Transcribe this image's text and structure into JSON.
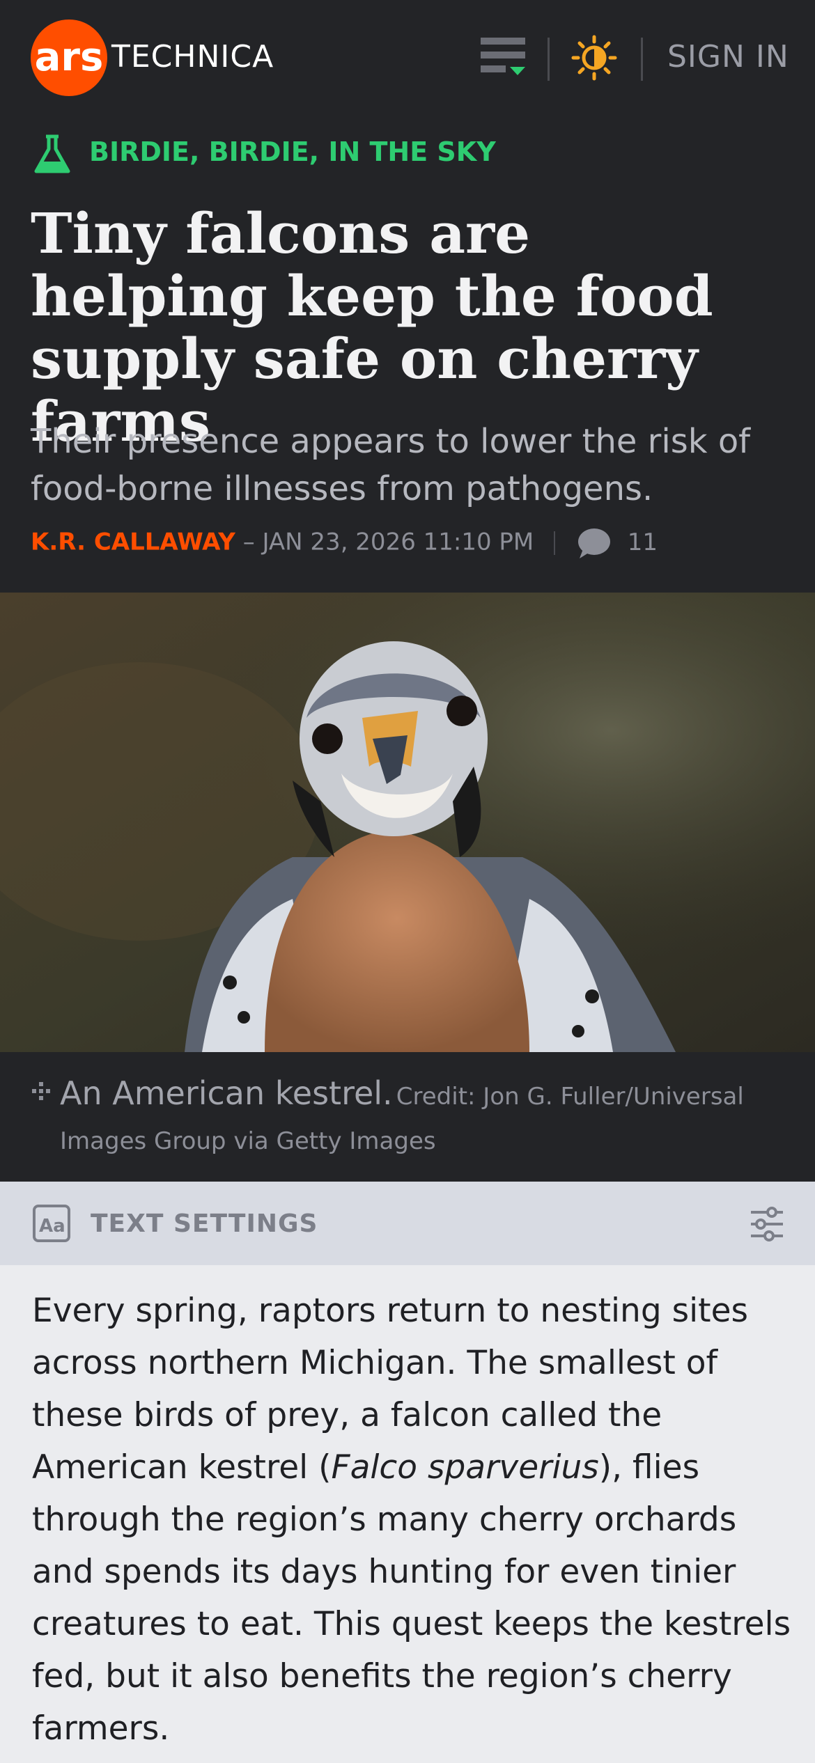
{
  "header": {
    "logo_ars": "ars",
    "logo_technica": "TECHNICA",
    "menu_icon": "menu-icon",
    "theme_icon": "sun-icon",
    "sign_in": "SIGN IN"
  },
  "article": {
    "kicker_icon": "flask-icon",
    "kicker": "BIRDIE, BIRDIE, IN THE SKY",
    "headline": "Tiny falcons are helping keep the food supply safe on cherry farms",
    "dek": "Their presence appears to lower the risk of food-borne illnesses from pathogens.",
    "author": "K.R. CALLAWAY",
    "date": "– JAN 23, 2026 11:10 PM",
    "comment_count": "11",
    "image_caption": "An American kestrel.",
    "image_credit": "Credit: Jon G. Fuller/Universal Images Group via Getty Images"
  },
  "text_settings": {
    "label": "TEXT SETTINGS"
  },
  "body": {
    "p1_before": "Every spring, raptors return to nesting sites across northern Michigan. The smallest of these birds of prey, a falcon called the American kestrel (",
    "p1_italic": "Falco sparverius",
    "p1_after": "), flies through the region’s many cherry orchards and spends its days hunting for even tinier creatures to eat. This quest keeps the kestrels fed, but it also benefits the region’s cherry farmers."
  },
  "colors": {
    "accent_orange": "#ff4e00",
    "kicker_green": "#2ecc71",
    "dark_bg": "#232427"
  }
}
